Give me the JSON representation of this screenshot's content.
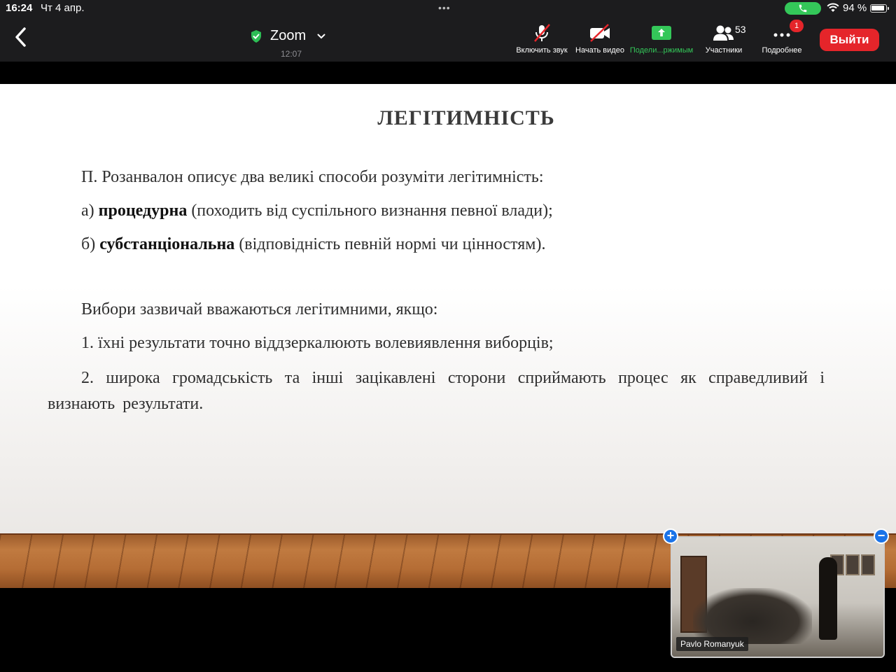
{
  "status_bar": {
    "time": "16:24",
    "date": "Чт 4 апр.",
    "multitask_dots": "•••",
    "battery_text": "94 %",
    "battery_level": 0.94,
    "call_pill_color": "#34c759"
  },
  "top_bar": {
    "meeting_title": "Zoom",
    "timer": "12:07",
    "buttons": [
      {
        "label": "Включить звук",
        "icon": "microphone-muted-icon"
      },
      {
        "label": "Начать видео",
        "icon": "video-off-icon"
      },
      {
        "label": "Подели...ржимым",
        "icon": "share-screen-icon"
      },
      {
        "label": "Участники",
        "icon": "participants-icon"
      },
      {
        "label": "Подробнее",
        "icon": "more-icon"
      }
    ],
    "participants_count": "53",
    "more_badge": "1",
    "leave_label": "Выйти",
    "accent_red": "#e5252a",
    "accent_green": "#34c759"
  },
  "slide": {
    "title": "ЛЕГІТИМНІСТЬ",
    "intro": "П. Розанвалон описує два великі способи розуміти легітимність:",
    "item_a": {
      "prefix": "а) ",
      "bold": "процедурна",
      "rest": " (походить від суспільного визнання певної влади);"
    },
    "item_b": {
      "prefix": "б) ",
      "bold": "субстанціональна",
      "rest": " (відповідність певній нормі чи цінностям)."
    },
    "elections_intro": "Вибори зазвичай вважаються легітимними, якщо:",
    "point_1": "1. їхні результати точно віддзеркалюють волевиявлення виборців;",
    "point_2": "2. широка громадськість та інші зацікавлені сторони сприймають процес як справедливий і визнають результати."
  },
  "video_tile": {
    "participant_name": "Pavlo Romanyuk",
    "expand_symbol": "+",
    "minimize_symbol": "−"
  }
}
